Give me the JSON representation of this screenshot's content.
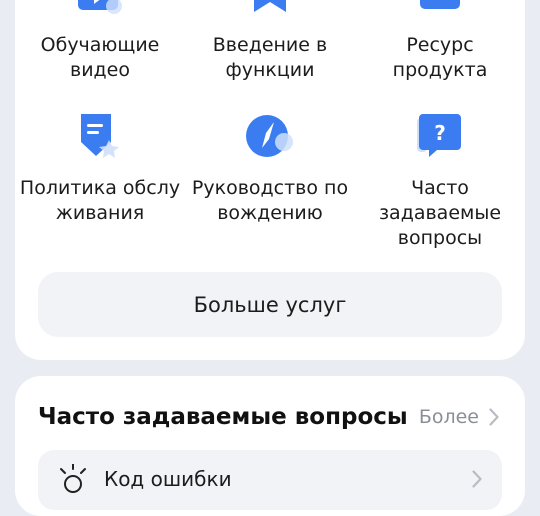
{
  "services": {
    "tiles": [
      {
        "label": "Обучающие\nвидео",
        "icon": "play-video-icon"
      },
      {
        "label": "Введение в\nфункции",
        "icon": "bookmark-icon"
      },
      {
        "label": "Ресурс\nпродукта",
        "icon": "folder-icon"
      },
      {
        "label": "Политика обслу\nживания",
        "icon": "shield-document-icon"
      },
      {
        "label": "Руководство по\nвождению",
        "icon": "compass-icon"
      },
      {
        "label": "Часто\nзадаваемые\nвопросы",
        "icon": "question-bubble-icon"
      }
    ],
    "more_label": "Больше услуг"
  },
  "faq": {
    "title": "Часто задаваемые вопросы",
    "more_label": "Более",
    "rows": [
      {
        "label": "Код ошибки",
        "icon": "warning-light-icon"
      }
    ]
  },
  "colors": {
    "accent": "#3b7cf0",
    "accent_light": "#cfe0fb",
    "background": "#e9edf3",
    "card": "#ffffff",
    "button": "#f1f3f6"
  }
}
